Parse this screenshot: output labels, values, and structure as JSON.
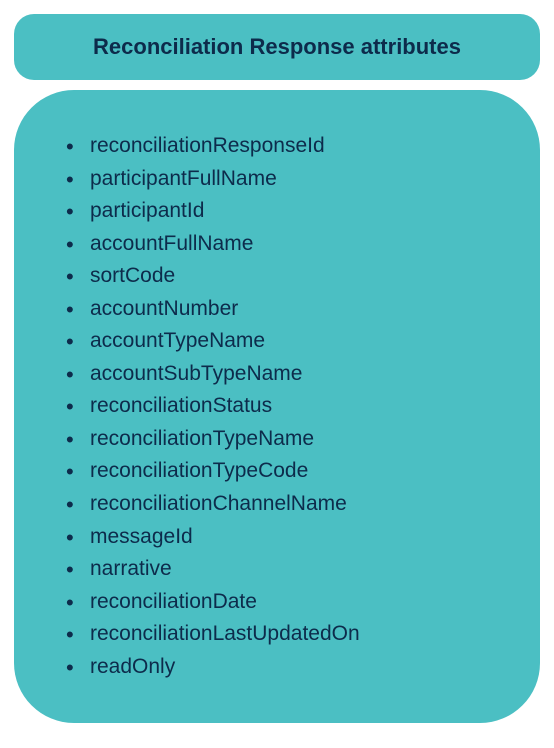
{
  "header": {
    "title": "Reconciliation Response attributes"
  },
  "attributes": [
    "reconciliationResponseId",
    "participantFullName",
    "participantId",
    "accountFullName",
    "sortCode",
    "accountNumber",
    "accountTypeName",
    "accountSubTypeName",
    "reconciliationStatus",
    "reconciliationTypeName",
    "reconciliationTypeCode",
    "reconciliationChannelName",
    "messageId",
    "narrative",
    "reconciliationDate",
    "reconciliationLastUpdatedOn",
    "readOnly"
  ]
}
